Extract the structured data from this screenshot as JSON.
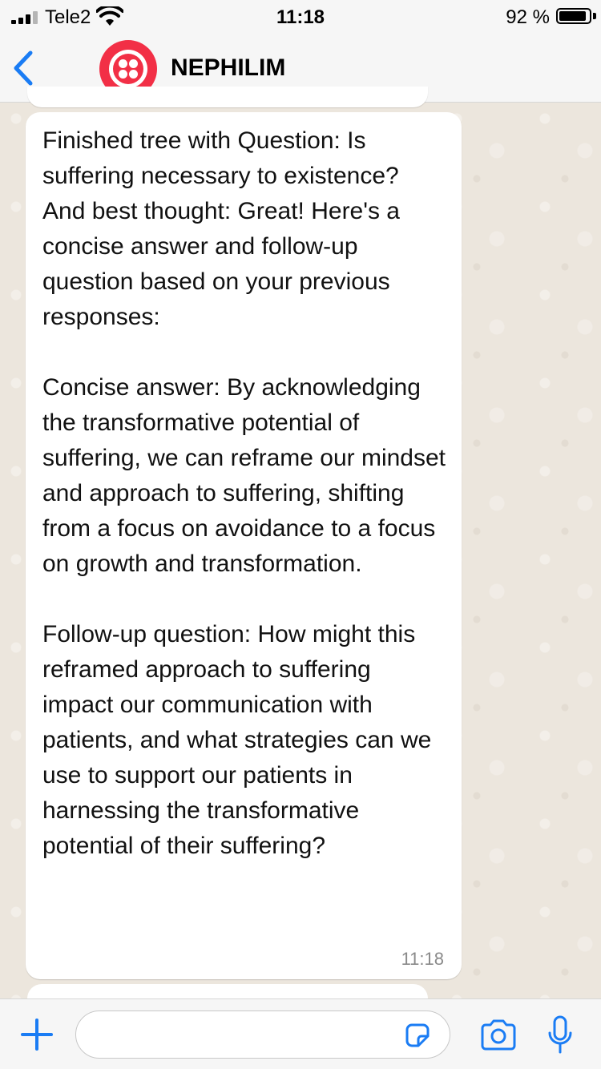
{
  "status_bar": {
    "carrier": "Tele2",
    "time": "11:18",
    "battery_percent": "92 %",
    "battery_level": 0.92
  },
  "header": {
    "contact_name": "NEPHILIM",
    "back_icon": "chevron-left-icon",
    "avatar_icon": "twilio-logo"
  },
  "messages": [
    {
      "text": "Finished tree with Question: Is suffering necessary to existence? And best thought: Great! Here's a concise answer and follow-up question based on your previous responses:\n\nConcise answer: By acknowledging the transformative potential of suffering, we can reframe our mindset and approach to suffering, shifting from a focus on avoidance to a focus on growth and transformation.\n\nFollow-up question: How might this reframed approach to suffering impact our communication with patients, and what strategies can we use to support our patients in harnessing the transformative potential of their suffering?",
      "time": "11:18"
    }
  ],
  "input_bar": {
    "placeholder": "",
    "value": "",
    "icons": [
      "plus-icon",
      "sticker-icon",
      "camera-icon",
      "microphone-icon"
    ]
  },
  "colors": {
    "accent": "#1a7cf4",
    "avatar": "#f22f46",
    "chat_background": "#ece6dd",
    "bubble": "#ffffff"
  }
}
